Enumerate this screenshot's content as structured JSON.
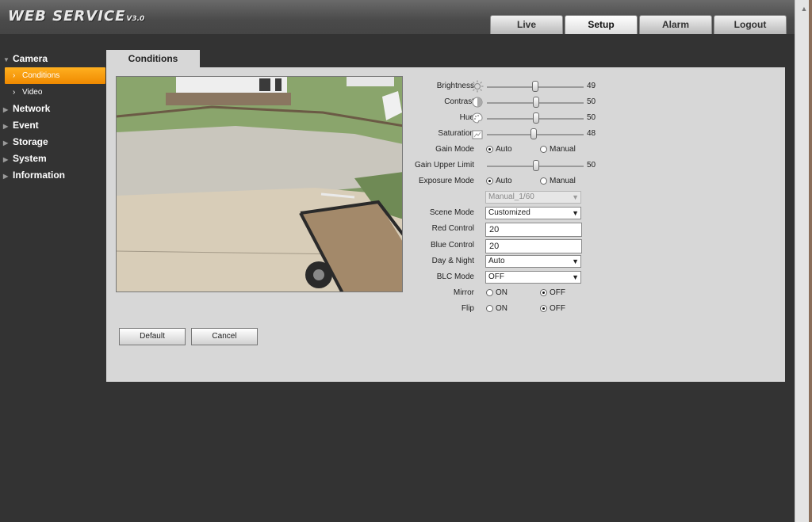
{
  "app": {
    "logo": "WEB  SERVICE",
    "version": "V3.0"
  },
  "top_tabs": [
    {
      "label": "Live",
      "active": false
    },
    {
      "label": "Setup",
      "active": true
    },
    {
      "label": "Alarm",
      "active": false
    },
    {
      "label": "Logout",
      "active": false
    }
  ],
  "sidebar": {
    "camera": "Camera",
    "conditions": "Conditions",
    "video": "Video",
    "network": "Network",
    "event": "Event",
    "storage": "Storage",
    "system": "System",
    "information": "Information"
  },
  "content_tab": "Conditions",
  "form": {
    "brightness": {
      "label": "Brightness",
      "value": "49",
      "icon": "sun-icon"
    },
    "contrast": {
      "label": "Contrast",
      "value": "50",
      "icon": "contrast-icon"
    },
    "hue": {
      "label": "Hue",
      "value": "50",
      "icon": "palette-icon"
    },
    "saturation": {
      "label": "Saturation",
      "value": "48",
      "icon": "saturation-icon"
    },
    "gain_mode": {
      "label": "Gain Mode",
      "opt1": "Auto",
      "opt2": "Manual",
      "selected": "Auto"
    },
    "gain_upper_limit": {
      "label": "Gain Upper Limit",
      "value": "50"
    },
    "exposure_mode": {
      "label": "Exposure Mode",
      "opt1": "Auto",
      "opt2": "Manual",
      "selected": "Auto"
    },
    "exposure_select": "Manual_1/60",
    "scene_mode": {
      "label": "Scene Mode",
      "value": "Customized"
    },
    "red_control": {
      "label": "Red Control",
      "value": "20"
    },
    "blue_control": {
      "label": "Blue Control",
      "value": "20"
    },
    "day_night": {
      "label": "Day & Night",
      "value": "Auto"
    },
    "blc_mode": {
      "label": "BLC Mode",
      "value": "OFF"
    },
    "mirror": {
      "label": "Mirror",
      "opt1": "ON",
      "opt2": "OFF",
      "selected": "OFF"
    },
    "flip": {
      "label": "Flip",
      "opt1": "ON",
      "opt2": "OFF",
      "selected": "OFF"
    }
  },
  "buttons": {
    "default": "Default",
    "cancel": "Cancel"
  },
  "colors": {
    "accent": "#f5a000",
    "background": "#333333",
    "panel": "#d7d7d7"
  }
}
